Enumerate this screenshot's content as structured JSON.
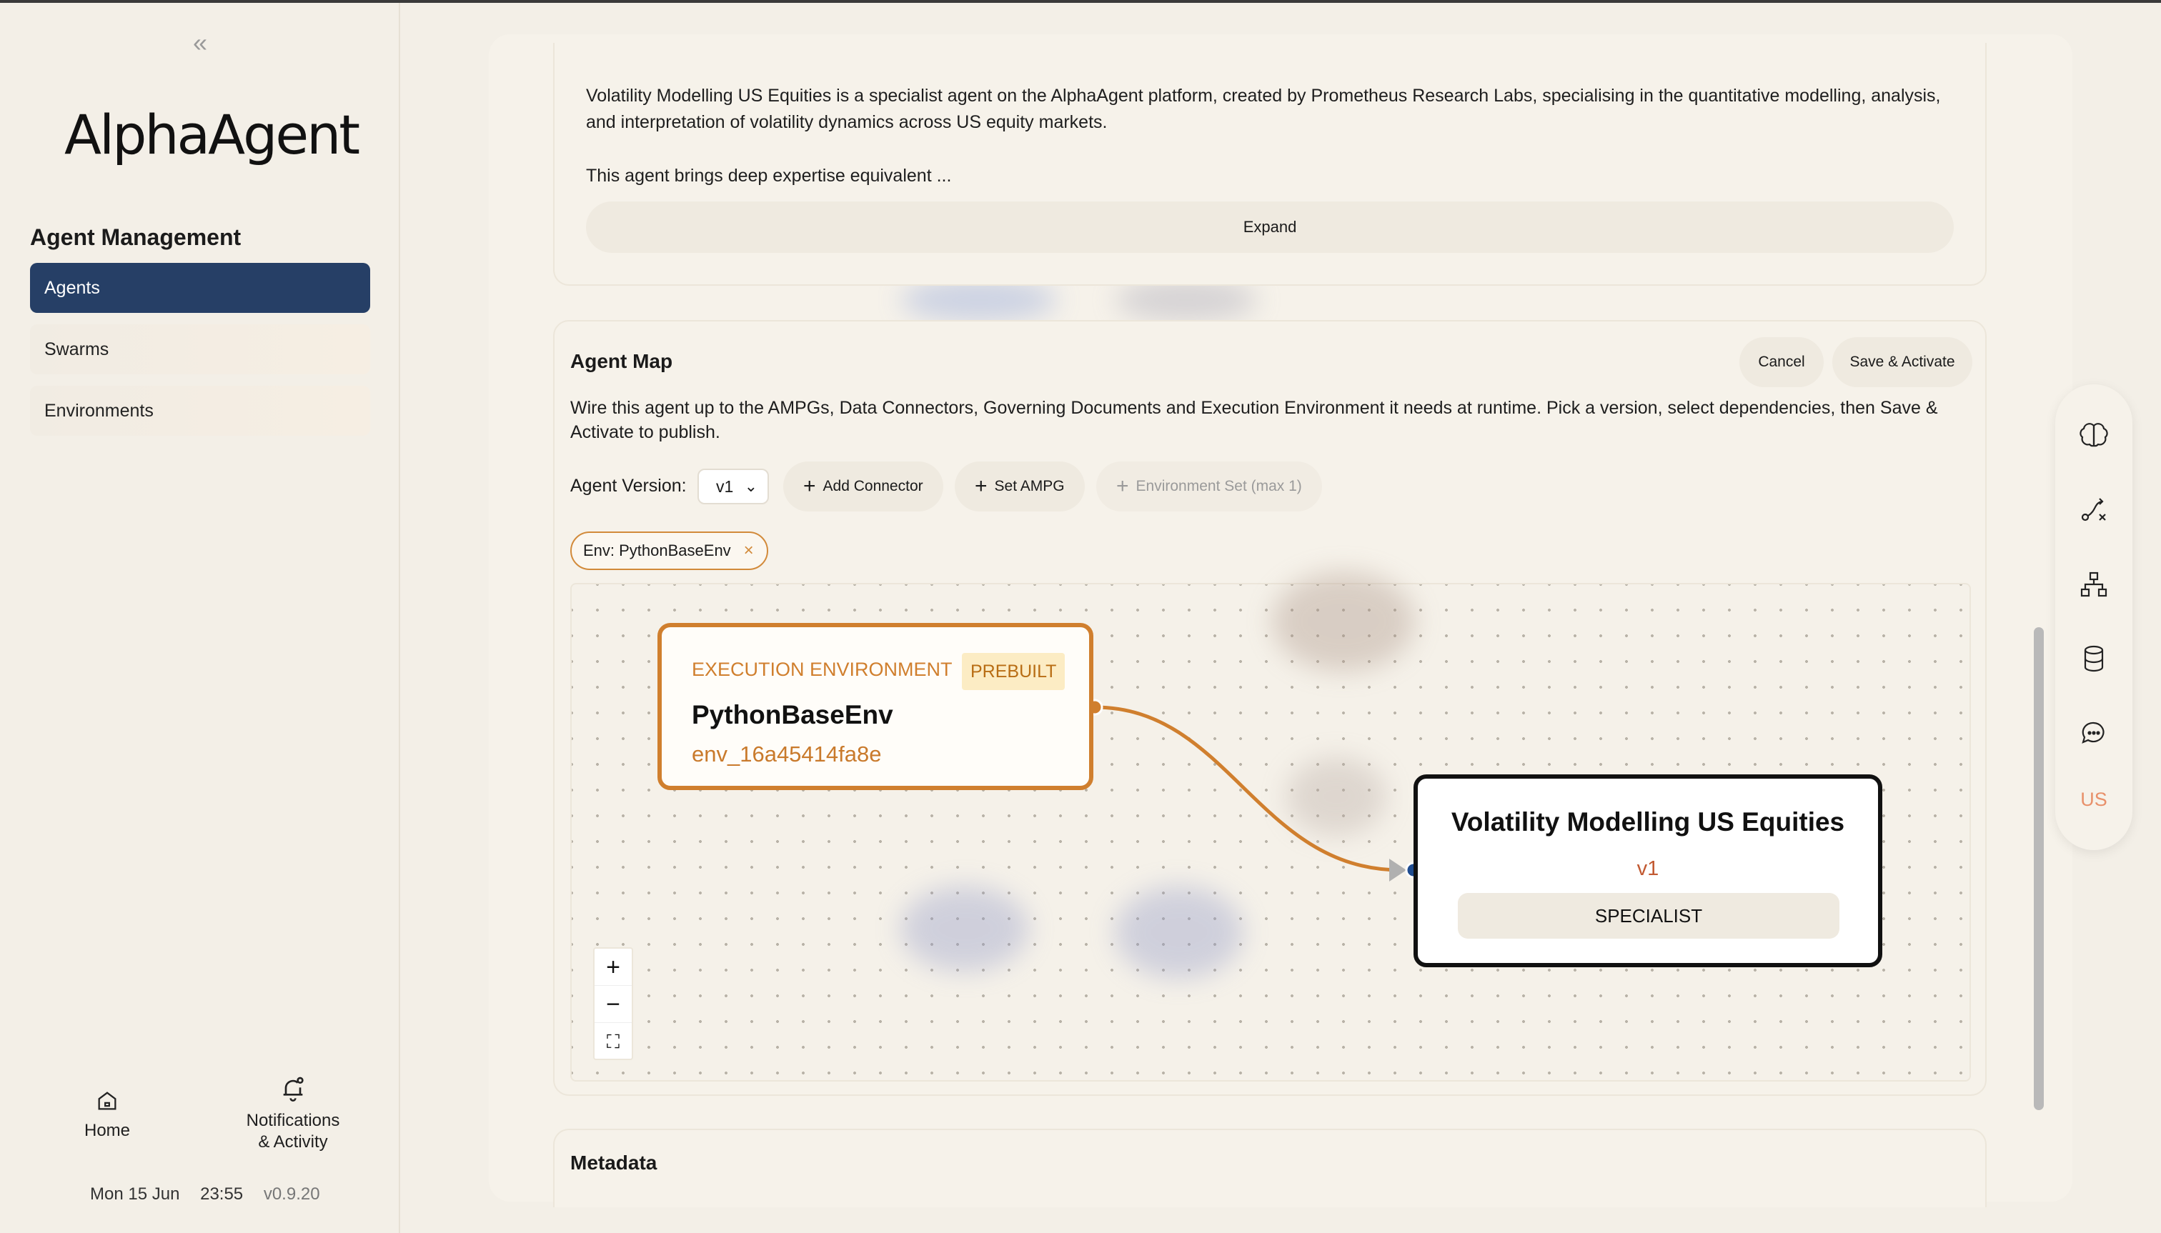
{
  "app": {
    "name": "AlphaAgent"
  },
  "sidebar": {
    "collapse_label": "«",
    "section_title": "Agent Management",
    "items": [
      {
        "label": "Agents",
        "active": true
      },
      {
        "label": "Swarms",
        "active": false
      },
      {
        "label": "Environments",
        "active": false
      }
    ],
    "bottom": {
      "home": "Home",
      "notif_line1": "Notifications",
      "notif_line2": "& Activity"
    },
    "footer": {
      "date": "Mon 15 Jun",
      "time": "23:55",
      "version": "v0.9.20"
    }
  },
  "description": {
    "paragraph1": "Volatility Modelling US Equities is a specialist agent on the AlphaAgent platform, created by Prometheus Research Labs, specialising in the quantitative modelling, analysis, and interpretation of volatility dynamics across US equity markets.",
    "paragraph2": "This agent brings deep expertise equivalent ...",
    "expand_label": "Expand"
  },
  "agent_map": {
    "title": "Agent Map",
    "cancel_label": "Cancel",
    "save_label": "Save & Activate",
    "description": "Wire this agent up to the AMPGs, Data Connectors, Governing Documents and Execution Environment it needs at runtime. Pick a version, select dependencies, then Save & Activate to publish.",
    "version_label": "Agent Version:",
    "version_value": "v1",
    "add_connector": "Add Connector",
    "set_ampg": "Set AMPG",
    "env_set": "Environment Set (max 1)",
    "env_tag": "Env: PythonBaseEnv",
    "env_tag_remove": "×",
    "zoom_in": "+",
    "zoom_out": "−",
    "fit_view": "⛶",
    "env_node": {
      "type": "EXECUTION ENVIRONMENT",
      "badge": "PREBUILT",
      "name": "PythonBaseEnv",
      "id": "env_16a45414fa8e"
    },
    "agent_node": {
      "name": "Volatility Modelling US Equities",
      "version": "v1",
      "role": "SPECIALIST"
    }
  },
  "metadata": {
    "title": "Metadata"
  },
  "right_toolbar": {
    "icons": [
      "brain-icon",
      "route-icon",
      "hierarchy-icon",
      "database-icon",
      "chat-icon"
    ],
    "user_initials": "US"
  },
  "colors": {
    "accent_navy": "#263f66",
    "env_orange": "#d07f2e",
    "badge_bg": "#fcecc4",
    "agent_version": "#c25a32",
    "user_initials": "#e8906a"
  }
}
